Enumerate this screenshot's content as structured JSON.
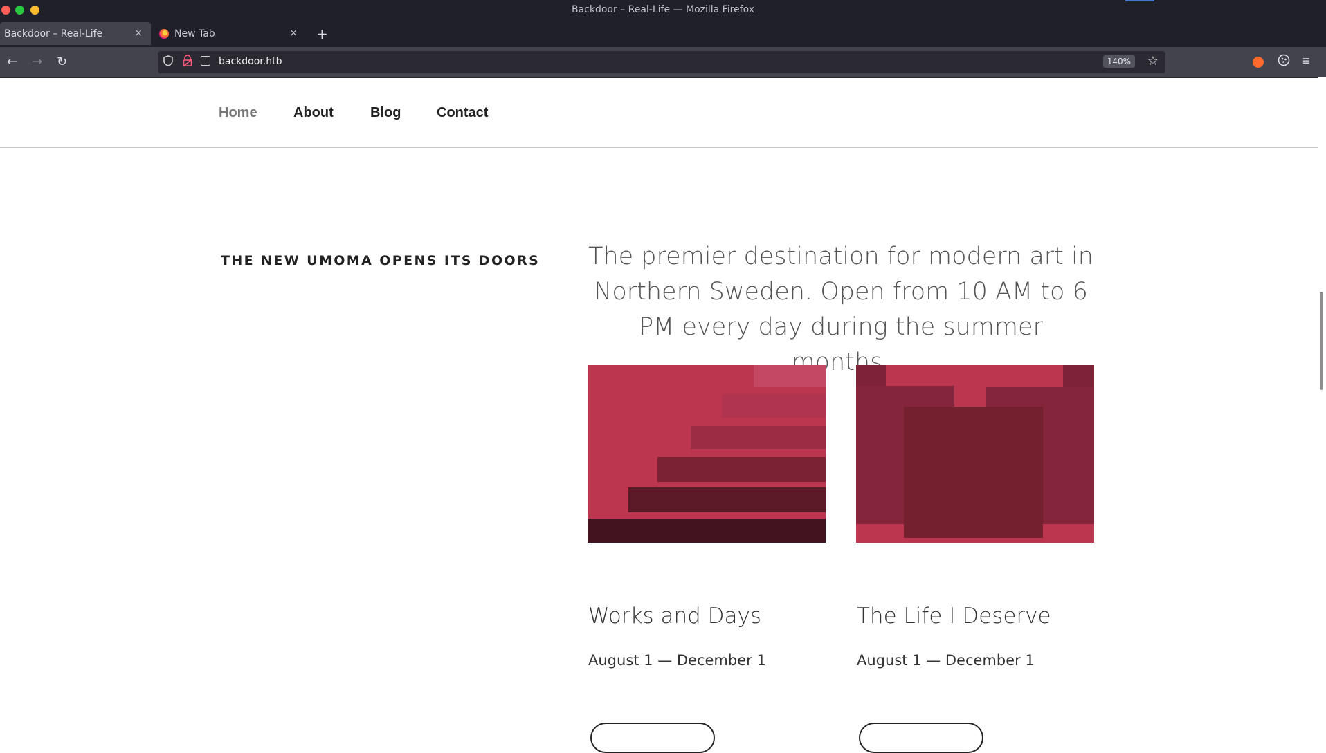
{
  "window": {
    "title": "Backdoor – Real-Life — Mozilla Firefox"
  },
  "tabs": [
    {
      "label": "Backdoor – Real-Life",
      "active": true,
      "close": "×"
    },
    {
      "label": "New Tab",
      "active": false,
      "close": "×"
    }
  ],
  "toolbar": {
    "new_tab": "+",
    "back": "←",
    "forward": "→",
    "reload": "↻",
    "url": "backdoor.htb",
    "zoom": "140%",
    "bookmark_star": "☆",
    "menu": "≡"
  },
  "site": {
    "nav": [
      {
        "label": "Home",
        "current": true
      },
      {
        "label": "About",
        "current": false
      },
      {
        "label": "Blog",
        "current": false
      },
      {
        "label": "Contact",
        "current": false
      }
    ],
    "section_heading": "THE NEW UMOMA OPENS ITS DOORS",
    "intro": "The premier destination for modern art in Northern Sweden. Open from 10 AM to 6 PM every day during the summer months.",
    "cards": [
      {
        "title": "Works and Days",
        "date": "August 1 — December 1"
      },
      {
        "title": "The Life I Deserve",
        "date": "August 1 — December 1"
      }
    ]
  },
  "colors": {
    "accent": "#bd3650",
    "chrome_dark": "#1f2029",
    "chrome_mid": "#42434d",
    "nav_current": "#767676"
  }
}
